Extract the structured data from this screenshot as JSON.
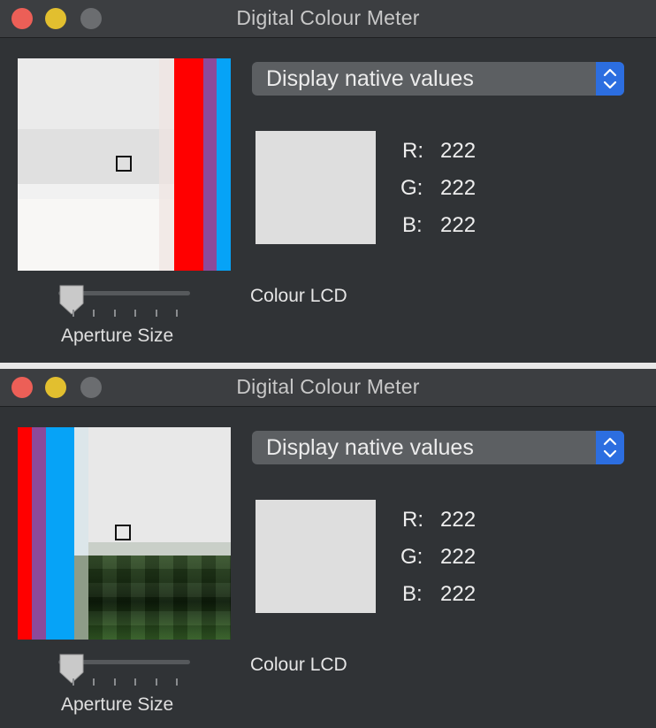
{
  "windows": [
    {
      "title": "Digital Colour Meter",
      "mode_select": {
        "value": "Display native values"
      },
      "sample_color": "#dedede",
      "rgb": {
        "r_label": "R:",
        "r": "222",
        "g_label": "G:",
        "g": "222",
        "b_label": "B:",
        "b": "222"
      },
      "display_name": "Colour LCD",
      "aperture": {
        "label": "Aperture Size",
        "level": 0
      }
    },
    {
      "title": "Digital Colour Meter",
      "mode_select": {
        "value": "Display native values"
      },
      "sample_color": "#dedede",
      "rgb": {
        "r_label": "R:",
        "r": "222",
        "g_label": "G:",
        "g": "222",
        "b_label": "B:",
        "b": "222"
      },
      "display_name": "Colour LCD",
      "aperture": {
        "label": "Aperture Size",
        "level": 0
      }
    }
  ],
  "colors": {
    "close": "#ec5f57",
    "minimize": "#e2bf2f",
    "zoom_disabled": "#6b6d70",
    "stepper_accent": "#2c6ee0"
  },
  "icons": [
    "aperture-square-icon",
    "select-stepper-icon",
    "slider-thumb-icon"
  ]
}
